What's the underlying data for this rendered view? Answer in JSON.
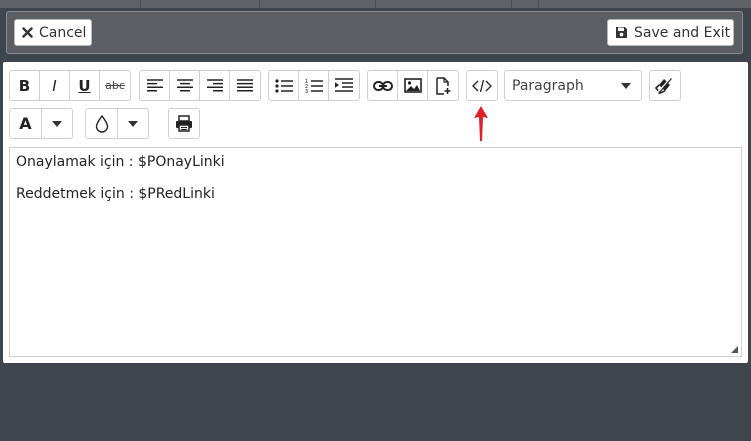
{
  "header": {
    "cancel_label": "Cancel",
    "save_label": "Save and Exit"
  },
  "toolbar": {
    "bold": "B",
    "italic": "I",
    "underline": "U",
    "strike": "abc",
    "format_select": "Paragraph",
    "font_color": "A"
  },
  "content": {
    "line1": "Onaylamak için : $POnayLinki",
    "line2": "Reddetmek için : $PRedLinki"
  },
  "colors": {
    "background": "#3f454c",
    "header_bar": "#5b5f63",
    "annotation_arrow": "#e0202a"
  }
}
